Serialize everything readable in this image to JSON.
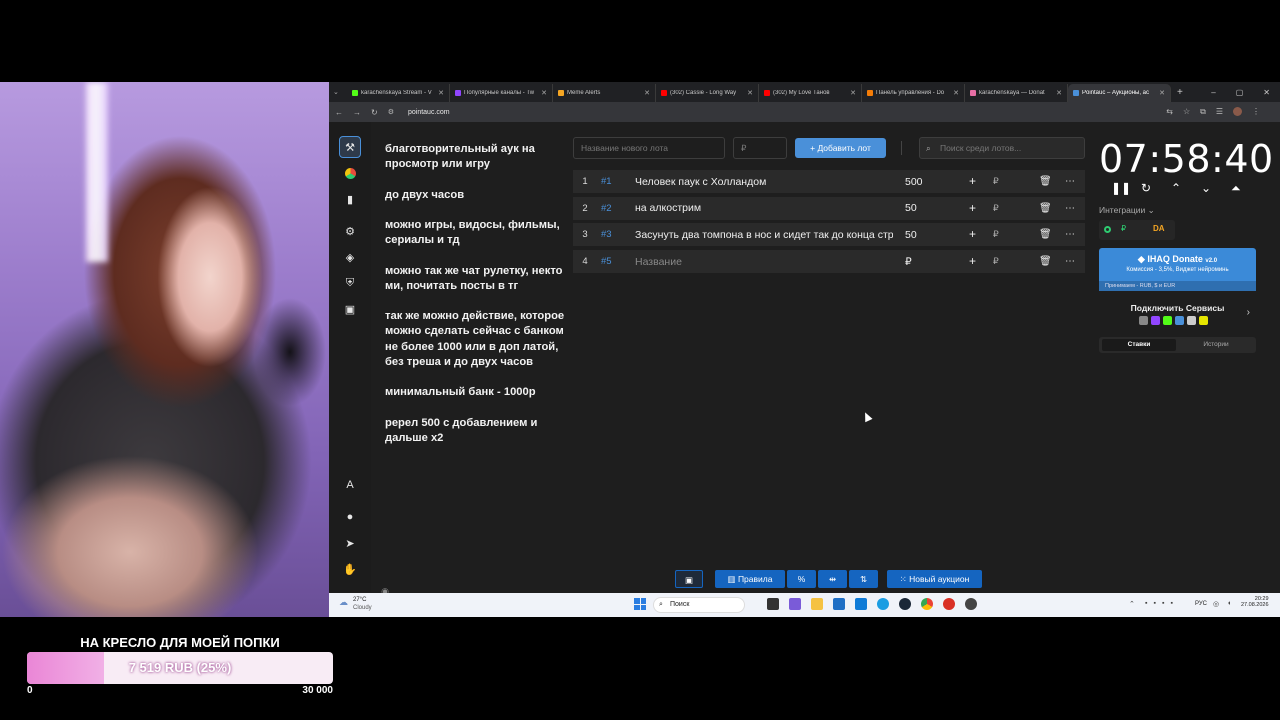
{
  "goal": {
    "title": "НА КРЕСЛО ДЛЯ МОЕЙ ПОПКИ",
    "progress_text": "7 519 RUB (25%)",
    "progress_fraction": 0.25,
    "min": "0",
    "max": "30 000"
  },
  "browser": {
    "tabs": [
      {
        "title": "karachenskaya Stream - V",
        "color": "#53fc18"
      },
      {
        "title": "Популярные каналы - Tw",
        "color": "#9146ff"
      },
      {
        "title": "Meme Alerts",
        "color": "#f5a623"
      },
      {
        "title": "(302) Cassie - Long Way",
        "color": "#ff0000"
      },
      {
        "title": "(302) My Love Танов",
        "color": "#ff0000"
      },
      {
        "title": "Панель управления - Do",
        "color": "#f57d07"
      },
      {
        "title": "karachenskaya — Donat",
        "color": "#e86fa5"
      },
      {
        "title": "Pointauc – Аукционы, ас",
        "color": "#4a90d9"
      }
    ],
    "new_tab": "+",
    "url": "pointauc.com"
  },
  "notes": [
    "благотворительный аук на просмотр или игру",
    "до  двух часов",
    "можно игры, видосы, фильмы, сериалы и тд",
    "можно так же чат рулетку, некто ми, почитать посты в тг",
    "так же можно действие, которое можно сделать сейчас с банком не более 1000 или в доп латой, без треша  и до двух часов",
    "минимальный банк - 1000р",
    "ререл 500 с добавлением и дальше х2"
  ],
  "lot_form": {
    "name_placeholder": "Название нового лота",
    "amount_placeholder": "₽",
    "add_button": "Добавить лот",
    "search_placeholder": "Поиск среди лотов..."
  },
  "lots": [
    {
      "num": "1",
      "fast": "#1",
      "name": "Человек паук с Холландом",
      "amount": "500"
    },
    {
      "num": "2",
      "fast": "#2",
      "name": "на алкострим",
      "amount": "50"
    },
    {
      "num": "3",
      "fast": "#3",
      "name": "Засунуть два томпона в нос и сидет так до конца стр",
      "amount": "50"
    },
    {
      "num": "4",
      "fast": "#5",
      "name": "Название",
      "amount": "₽"
    }
  ],
  "currency": "₽",
  "timer": "07:58:40",
  "integrations": {
    "label": "Интеграции",
    "rub": "₽",
    "da": "DA"
  },
  "donate": {
    "title": "IHAQ Donate",
    "version": "v2.0",
    "subtitle": "Комиссия - 3,5%, Виджет нейроминь",
    "accepts": "Принимаем - RUB, $ и EUR"
  },
  "connect": {
    "title": "Подключить Сервисы"
  },
  "segments": {
    "bids": "Ставки",
    "history": "Истории"
  },
  "bottom": {
    "rules": "Правила",
    "new_auction": "Новый аукцион"
  },
  "taskbar": {
    "temp": "27°C",
    "weather": "Cloudy",
    "search": "Поиск",
    "lang": "РУС",
    "time": "20:29",
    "date": "27.08.2026"
  },
  "colors": {
    "accent": "#4a90d9",
    "goal_fill": "#ea86d6"
  }
}
